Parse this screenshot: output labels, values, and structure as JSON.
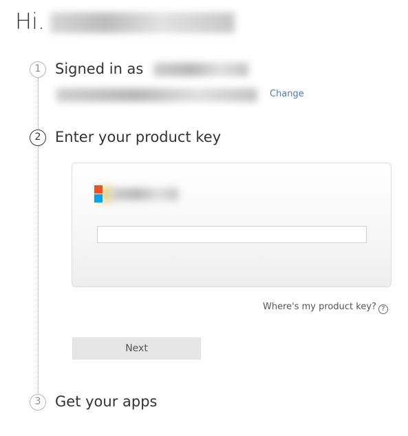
{
  "greeting": {
    "text": "Hi."
  },
  "steps": [
    {
      "number": "1",
      "title": "Signed in as",
      "action_label": "Change"
    },
    {
      "number": "2",
      "title": "Enter your product key"
    },
    {
      "number": "3",
      "title": "Get your apps"
    }
  ],
  "product_key": {
    "input_value": "",
    "help_link": "Where's my product key?",
    "help_icon": "?"
  },
  "next_button": {
    "label": "Next"
  },
  "colors": {
    "link": "#4a7bb6",
    "logo_red": "#f25022",
    "logo_blue": "#00a4ef",
    "button_bg": "#e6e6e6"
  },
  "icons": {
    "logo": "microsoft-logo-icon",
    "help": "question-circle-icon"
  }
}
